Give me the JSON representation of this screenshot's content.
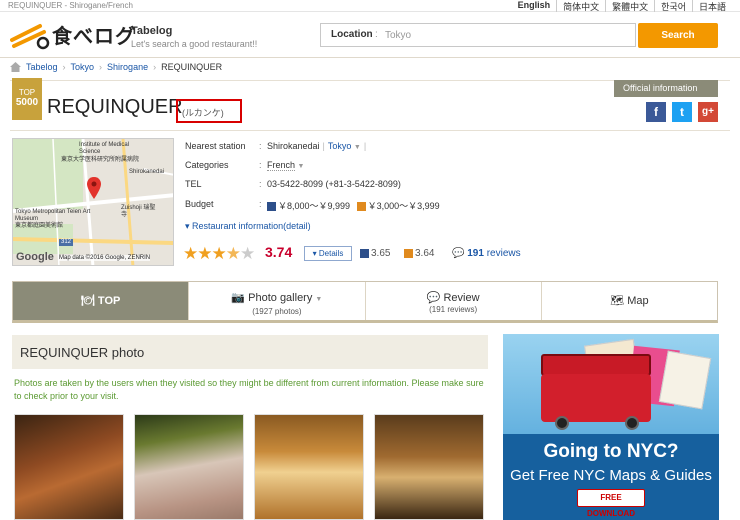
{
  "top": {
    "caption": "REQUINQUER - Shirogane/French",
    "languages": [
      "English",
      "简体中文",
      "繁體中文",
      "한국어",
      "日本語"
    ]
  },
  "header": {
    "logo_text": "食べログ",
    "brand": "Tabelog",
    "tagline": "Let's search a good restaurant!!",
    "location_label": "Location",
    "location_colon": ":",
    "location_placeholder": "Tokyo",
    "search_button": "Search"
  },
  "breadcrumb": [
    "Tabelog",
    "Tokyo",
    "Shirogane",
    "REQUINQUER"
  ],
  "restaurant": {
    "badge_top": "TOP",
    "badge_num": "5000",
    "name": "REQUINQUER",
    "kana": "(ルカンケ)",
    "official": "Official information"
  },
  "social": {
    "facebook": "f",
    "twitter": "t",
    "google": "g+"
  },
  "map": {
    "credit": "Map data ©2016 Google, ZENRIN",
    "google": "Google",
    "labels": [
      "Institute of Medical Science",
      "東京大学医科研究所附属病院",
      "Shirokanedai",
      "Tokyo Metropolitan Teien Art Museum",
      "東京都庭園美術館",
      "Zuishoji 瑞聖寺",
      "312"
    ]
  },
  "info": {
    "station_key": "Nearest station",
    "station_val": "Shirokanedai",
    "station_city": "Tokyo",
    "categories_key": "Categories",
    "categories_val": "French",
    "tel_key": "TEL",
    "tel_val": "03-5422-8099 (+81-3-5422-8099)",
    "budget_key": "Budget",
    "budget_dinner": "￥8,000～￥9,999",
    "budget_lunch": "￥3,000～￥3,999",
    "detail_link": "Restaurant information(detail)",
    "colon": ":"
  },
  "rating": {
    "stars": "★★★★☆",
    "score": "3.74",
    "details": "Details",
    "dinner": "3.65",
    "lunch": "3.64",
    "reviews_count": "191",
    "reviews_label": "reviews"
  },
  "tabs": [
    {
      "label": "TOP",
      "sub": ""
    },
    {
      "label": "Photo gallery",
      "sub": "(1927 photos)"
    },
    {
      "label": "Review",
      "sub": "(191 reviews)"
    },
    {
      "label": "Map",
      "sub": ""
    }
  ],
  "photos": {
    "heading": "REQUINQUER photo",
    "note": "Photos are taken by the users when they visited so they might be different from current information. Please make sure to check prior to your visit."
  },
  "ad": {
    "headline": "Going to NYC?",
    "subline": "Get Free NYC Maps & Guides",
    "button": "FREE DOWNLOAD"
  },
  "colors": {
    "accent": "#f39800",
    "link": "#1a56a6",
    "score": "#c8002c",
    "tab_active": "#8b8b78"
  }
}
